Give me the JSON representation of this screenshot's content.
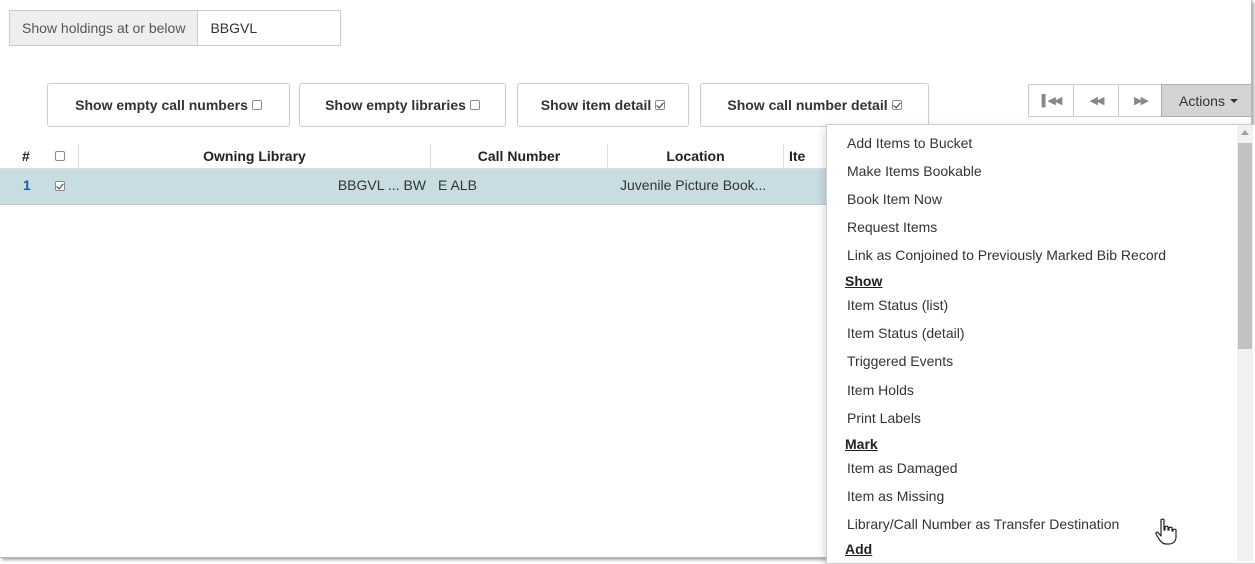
{
  "holdings": {
    "label": "Show holdings at or below",
    "value": "BBGVL"
  },
  "toggles": [
    {
      "label": "Show empty call numbers",
      "checked": false
    },
    {
      "label": "Show empty libraries",
      "checked": false
    },
    {
      "label": "Show item detail",
      "checked": true
    },
    {
      "label": "Show call number detail",
      "checked": true
    }
  ],
  "pager": {
    "first": "first-page-icon",
    "prev": "prev-page-icon",
    "next": "next-page-icon"
  },
  "actions_label": "Actions",
  "grid": {
    "headers": {
      "num": "#",
      "owning_library": "Owning Library",
      "call_number": "Call Number",
      "location": "Location",
      "item": "Ite"
    },
    "rows": [
      {
        "num": "1",
        "checked": true,
        "owning_library": "BBGVL ... BW",
        "call_number": "E ALB",
        "location": "Juvenile Picture Book..."
      }
    ]
  },
  "menu": {
    "items_top": [
      "Add Items to Bucket",
      "Make Items Bookable",
      "Book Item Now",
      "Request Items",
      "Link as Conjoined to Previously Marked Bib Record"
    ],
    "show_header": "Show",
    "show_items": [
      "Item Status (list)",
      "Item Status (detail)",
      "Triggered Events",
      "Item Holds",
      "Print Labels"
    ],
    "mark_header": "Mark",
    "mark_items": [
      "Item as Damaged",
      "Item as Missing",
      "Library/Call Number as Transfer Destination"
    ],
    "add_header": "Add"
  },
  "colors": {
    "selected_row": "#c7dde2",
    "actions_bg": "#d4d4d4",
    "row_number": "#1a5aa0"
  }
}
